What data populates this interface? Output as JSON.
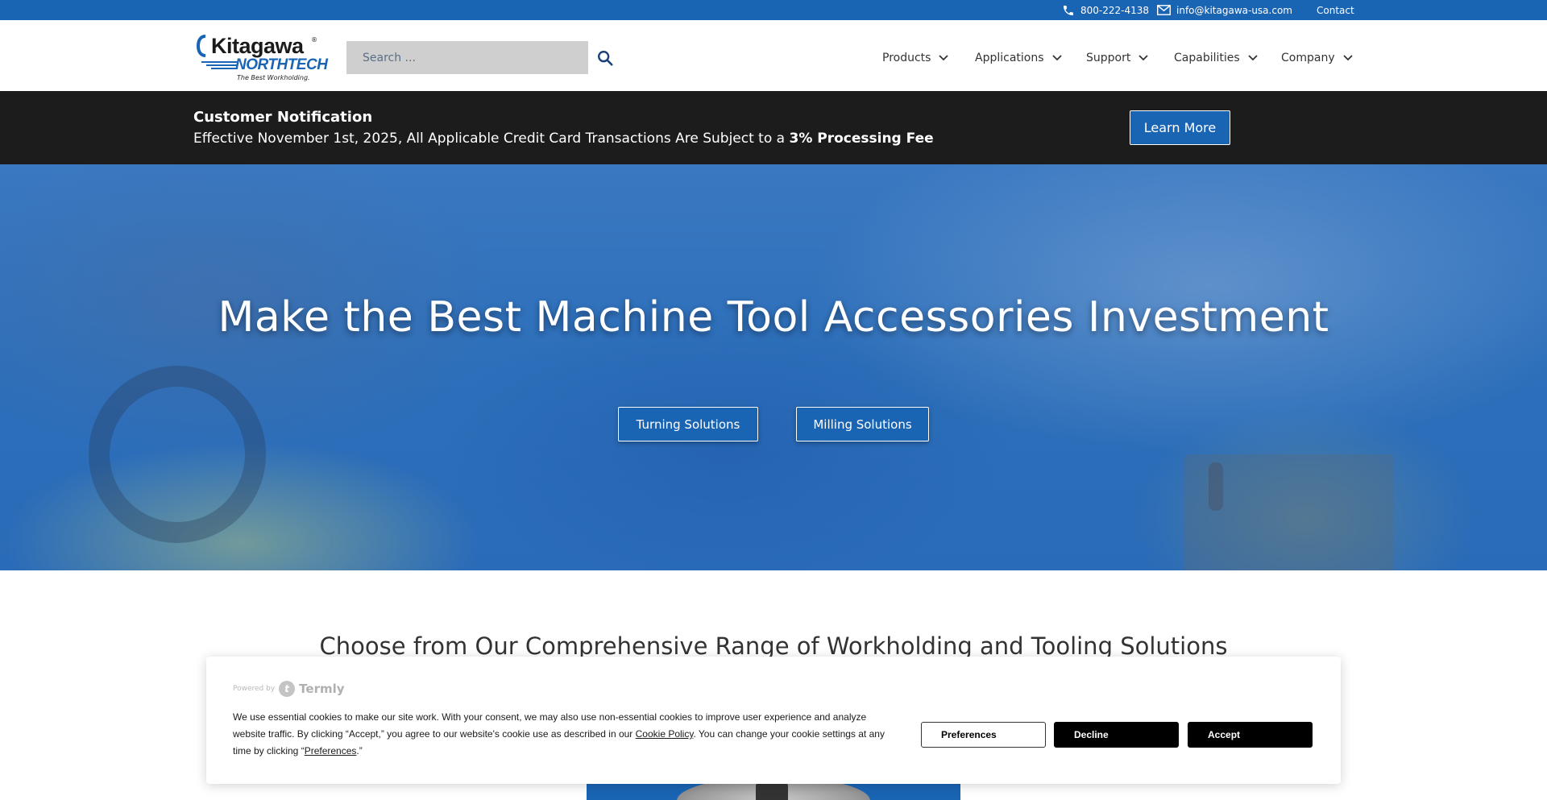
{
  "topbar": {
    "phone": "800-222-4138",
    "email": "info@kitagawa-usa.com",
    "contact": "Contact"
  },
  "logo": {
    "word_main_a": "K",
    "word_main_b": "ita",
    "word_main_c": "gawa",
    "registered": "®",
    "word_sub": "NORTHTECH",
    "tagline": "The Best Workholding."
  },
  "search": {
    "placeholder": "Search ..."
  },
  "nav": {
    "items": [
      {
        "label": "Products"
      },
      {
        "label": "Applications"
      },
      {
        "label": "Support"
      },
      {
        "label": "Capabilities"
      },
      {
        "label": "Company"
      }
    ]
  },
  "notice": {
    "title": "Customer Notification",
    "message": "Effective November 1st, 2025, All Applicable Credit Card Transactions Are Subject to a ",
    "message_bold": "3% Processing Fee",
    "button": "Learn More"
  },
  "hero": {
    "title": "Make the Best Machine Tool Accessories Investment",
    "buttons": [
      {
        "label": "Turning Solutions"
      },
      {
        "label": "Milling Solutions"
      }
    ]
  },
  "section": {
    "title": "Choose from Our Comprehensive Range of Workholding and Tooling Solutions"
  },
  "cookie": {
    "powered_by": "Powered by",
    "brand": "Termly",
    "text_1": "We use essential cookies to make our site work. With your consent, we may also use non-essential cookies to improve user experience and analyze website traffic. By clicking “Accept,” you agree to our website's cookie use as described in our ",
    "link_policy": "Cookie Policy",
    "text_2": ". You can change your cookie settings at any time by clicking “",
    "link_preferences": "Preferences",
    "text_3": ".”",
    "buttons": {
      "preferences": "Preferences",
      "decline": "Decline",
      "accept": "Accept"
    }
  },
  "colors": {
    "brand_blue": "#1a64b4",
    "notice_bg": "#1c1c1c",
    "search_bg": "#cfcfcf"
  },
  "icons": [
    "phone-icon",
    "mail-icon",
    "search-icon",
    "chevron-down-icon",
    "termly-logo-icon"
  ]
}
